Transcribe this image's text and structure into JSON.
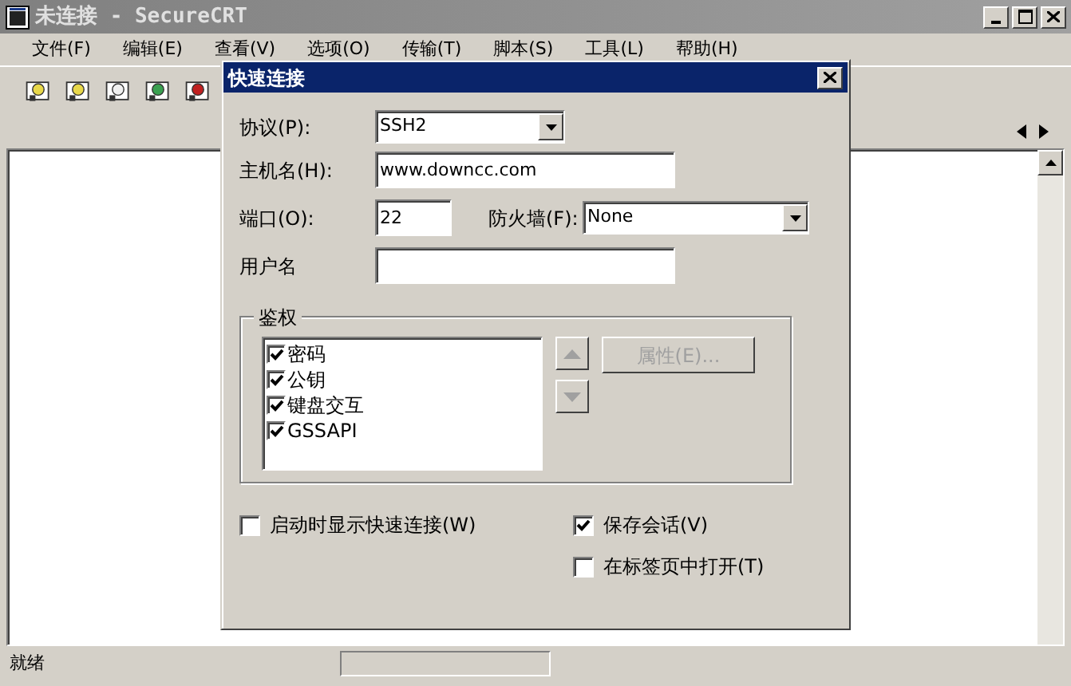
{
  "window": {
    "title": "未连接 - SecureCRT"
  },
  "menu": [
    "文件(F)",
    "编辑(E)",
    "查看(V)",
    "选项(O)",
    "传输(T)",
    "脚本(S)",
    "工具(L)",
    "帮助(H)"
  ],
  "dialog": {
    "title": "快速连接",
    "protocol": {
      "label": "协议(P):",
      "value": "SSH2"
    },
    "hostname": {
      "label": "主机名(H):",
      "value": "www.downcc.com"
    },
    "port": {
      "label": "端口(O):",
      "value": "22"
    },
    "firewall": {
      "label": "防火墙(F):",
      "value": "None"
    },
    "username": {
      "label": "用户名"
    },
    "auth": {
      "title": "鉴权",
      "items": [
        {
          "label": "密码",
          "checked": true
        },
        {
          "label": "公钥",
          "checked": true
        },
        {
          "label": "键盘交互",
          "checked": true
        },
        {
          "label": "GSSAPI",
          "checked": true
        }
      ],
      "properties_button": {
        "label": "属性(E)...",
        "disabled": true
      }
    },
    "options": [
      {
        "label": "启动时显示快速连接(W)",
        "checked": false
      },
      {
        "label": "保存会话(V)",
        "checked": true
      },
      {
        "label": "在标签页中打开(T)",
        "checked": false
      }
    ]
  },
  "status_bar": {
    "text": "就绪"
  }
}
